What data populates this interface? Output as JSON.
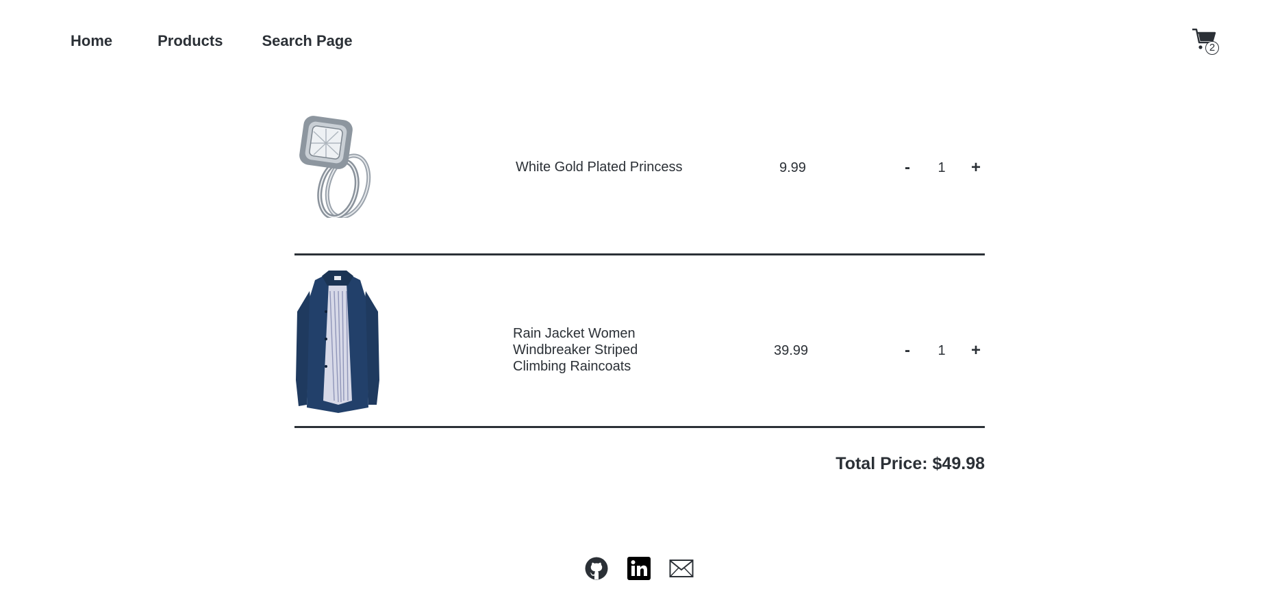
{
  "nav": {
    "links": [
      "Home",
      "Products",
      "Search Page"
    ]
  },
  "cart_icon": {
    "icon": "shopping-cart-icon",
    "count": "2"
  },
  "cart": {
    "items": [
      {
        "title": "White Gold Plated Princess",
        "price": "9.99",
        "quantity": "1",
        "decrement_label": "-",
        "increment_label": "+",
        "image": "ring-image"
      },
      {
        "title": "Rain Jacket Women Windbreaker Striped Climbing Raincoats",
        "price": "39.99",
        "quantity": "1",
        "decrement_label": "-",
        "increment_label": "+",
        "image": "rain-jacket-image"
      }
    ],
    "total_label": "Total Price: $49.98"
  },
  "footer": {
    "icons": [
      "github-icon",
      "linkedin-icon",
      "email-icon"
    ]
  },
  "colors": {
    "text": "#2b3036",
    "divider": "#2b3036",
    "background": "#ffffff",
    "jacket": "#1f3a5f"
  }
}
